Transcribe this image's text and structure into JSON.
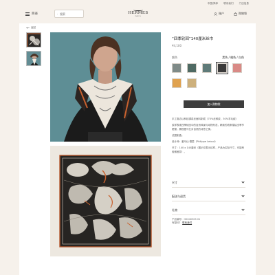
{
  "utility": {
    "links": [
      "中国/简体",
      "联系我们",
      "门店信息"
    ]
  },
  "header": {
    "menu_label": "目录",
    "search_placeholder": "搜索",
    "brand": "HERMES",
    "brand_sub": "PARIS",
    "account_label": "账户",
    "cart_label": "购物袋"
  },
  "product": {
    "back_label": "返回",
    "title": "“四季轮回”140厘米丝巾",
    "price": "¥4,100",
    "color_label": "颜色",
    "color_value": "黑色 / 橙色 / 白色",
    "swatches": [
      {
        "name": "swatch-1",
        "color": "#7f8b88"
      },
      {
        "name": "swatch-2",
        "color": "#4f6a63"
      },
      {
        "name": "swatch-3",
        "color": "#5f7b79"
      },
      {
        "name": "swatch-4",
        "color": "#3a3a3a",
        "selected": true
      },
      {
        "name": "swatch-5",
        "color": "#d98a86"
      },
      {
        "name": "swatch-6",
        "color": "#e0a24f"
      },
      {
        "name": "swatch-7",
        "color": "#cdb07c"
      }
    ],
    "add_to_cart": "加入购物袋",
    "description": [
      "手工卷边以斜纹绸真丝面料制成（70%丝斜纹，30%羊毛绒）",
      "纹样表现四季轮回中的自然风景与动物形态，精致的线条描绘出季节更替，展现爱马仕对自然的诗意之美。",
      "法国制造。",
      "设计师：爱马仕·德里（Philippe Letout）",
      "尺寸：140 x 140厘米（图示仅表示纹样，产品为实际尺寸，可能有轻微差异）。"
    ],
    "accordions": [
      "尺寸",
      "配送与退货",
      "礼物"
    ],
    "ref_label": "产品编号：H004030S 01",
    "help_label": "有疑问？",
    "help_link": "联系我们"
  }
}
